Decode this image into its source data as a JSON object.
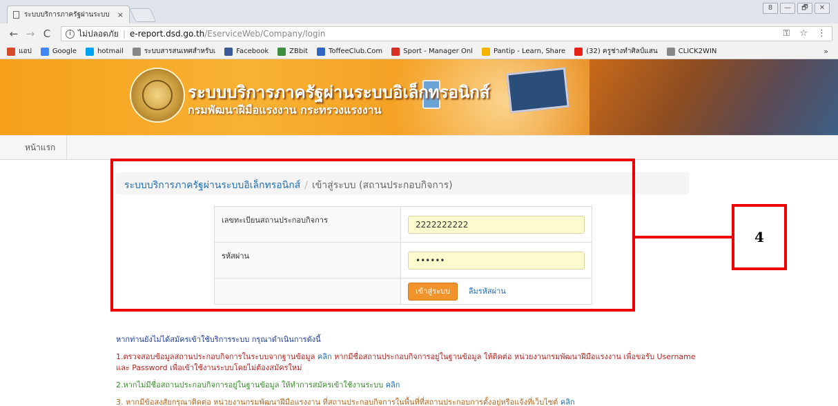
{
  "browser": {
    "tab_title": "ระบบบริการภาครัฐผ่านระบบ",
    "tab_close": "×",
    "window_buttons": [
      "8",
      "—",
      "🗗",
      "✕"
    ],
    "security_label": "ไม่ปลอดภัย",
    "url_host": "e-report.dsd.go.th",
    "url_path": "/EserviceWeb/Company/login",
    "bookmarks": [
      {
        "label": "แอป",
        "icon": "apps-grid-icon",
        "color": "#d54b2a"
      },
      {
        "label": "Google",
        "icon": "google-icon",
        "color": "#4285f4"
      },
      {
        "label": "hotmail",
        "icon": "windows-icon",
        "color": "#00a1f1"
      },
      {
        "label": "ระบบสารสนเทศสำหรับเ",
        "icon": "page-icon",
        "color": "#888888"
      },
      {
        "label": "Facebook",
        "icon": "facebook-icon",
        "color": "#3b5998"
      },
      {
        "label": "ZBbit",
        "icon": "zbbit-icon",
        "color": "#3e8e41"
      },
      {
        "label": "ToffeeClub.Com",
        "icon": "toffee-icon",
        "color": "#2f66c2"
      },
      {
        "label": "Sport - Manager Onl",
        "icon": "gmail-icon",
        "color": "#d93025"
      },
      {
        "label": "Pantip - Learn, Share",
        "icon": "pantip-icon",
        "color": "#f4b400"
      },
      {
        "label": "(32) ครูช่างทำศิลป์แสน",
        "icon": "youtube-icon",
        "color": "#e62117"
      },
      {
        "label": "CLICK2WIN",
        "icon": "page-icon",
        "color": "#888888"
      }
    ],
    "bookmarks_more": "»"
  },
  "banner": {
    "title": "ระบบบริการภาครัฐผ่านระบบอิเล็กทรอนิกส์",
    "subtitle": "กรมพัฒนาฝีมือแรงงาน กระทรวงแรงงาน"
  },
  "menu": {
    "home": "หน้าแรก"
  },
  "breadcrumb": {
    "root": "ระบบบริการภาครัฐผ่านระบบอิเล็กทรอนิกส์",
    "separator": "/",
    "current": "เข้าสู่ระบบ (สถานประกอบกิจการ)"
  },
  "form": {
    "reg_label": "เลขทะเบียนสถานประกอบกิจการ",
    "reg_value": "2222222222",
    "password_label": "รหัสผ่าน",
    "password_value": "••••••",
    "login_button": "เข้าสู่ระบบ",
    "forgot_link": "ลืมรหัสผ่าน"
  },
  "annotation": {
    "callout_number": "4",
    "color": "#ee0000"
  },
  "info": {
    "intro": "หากท่านยังไม่ได้สมัครเข้าใช้บริการระบบ กรุณาดำเนินการดังนี้",
    "step1_a": "1.ตรวจสอบข้อมูลสถานประกอบกิจการในระบบจากฐานข้อมูล",
    "step1_link": "คลิก",
    "step1_b": "หากมีชื่อสถานประกอบกิจการอยู่ในฐานข้อมูล ให้ติดต่อ หน่วยงานกรมพัฒนาฝีมือแรงงาน เพื่อขอรับ Username",
    "step1_c": "และ Password เพื่อเข้าใช้งานระบบโดยไม่ต้องสมัครใหม่",
    "step2": "2.หากไม่มีชื่อสถานประกอบกิจการอยู่ในฐานข้อมูล ให้ทำการสมัครเข้าใช้งานระบบ",
    "step2_link": "คลิก",
    "step3": "3. หากมีข้อสงสัยกรุณาติดต่อ หน่วยงานกรมพัฒนาฝีมือแรงงาน ที่สถานประกอบกิจการในพื้นที่ที่สถานประกอบการตั้งอยู่หรือแจ้งที่เว็บไซต์",
    "step3_link": "คลิก"
  }
}
